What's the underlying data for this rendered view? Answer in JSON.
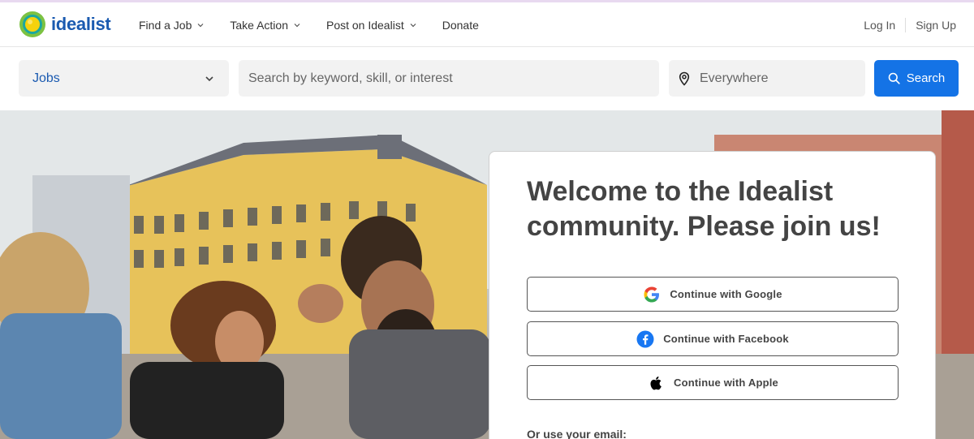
{
  "brand": {
    "name": "idealist"
  },
  "nav": {
    "items": [
      {
        "label": "Find a Job"
      },
      {
        "label": "Take Action"
      },
      {
        "label": "Post on Idealist"
      },
      {
        "label": "Donate"
      }
    ],
    "login": "Log In",
    "signup": "Sign Up"
  },
  "search": {
    "type_selected": "Jobs",
    "keyword_placeholder": "Search by keyword, skill, or interest",
    "location_placeholder": "Everywhere",
    "button_label": "Search"
  },
  "card": {
    "title": "Welcome to the Idealist community. Please join us!",
    "google_label": "Continue with Google",
    "facebook_label": "Continue with Facebook",
    "apple_label": "Continue with Apple",
    "email_prompt": "Or use your email:"
  },
  "colors": {
    "accent": "#1473e6",
    "brand_text": "#1a5ab0",
    "facebook": "#1877f2"
  }
}
